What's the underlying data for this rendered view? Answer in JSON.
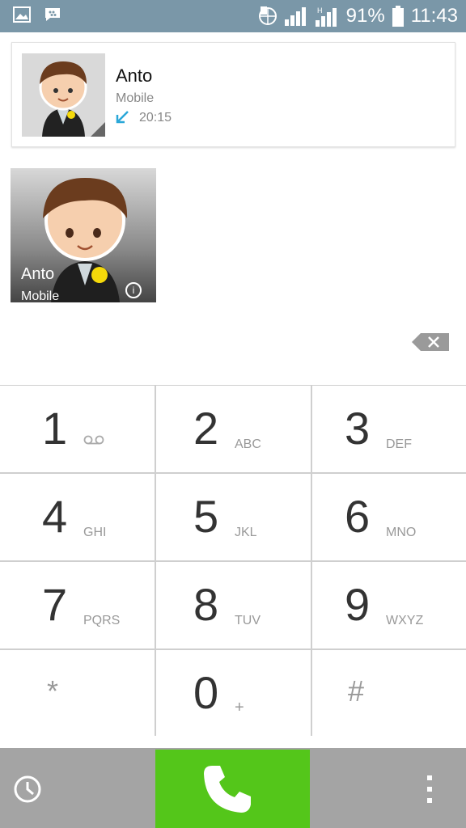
{
  "status_bar": {
    "battery_percent": "91%",
    "time": "11:43",
    "icons": [
      "gallery-icon",
      "bbm-icon",
      "data-sync-icon",
      "signal-icon",
      "hspa-signal-icon",
      "battery-icon"
    ]
  },
  "recent_call": {
    "name": "Anto",
    "type": "Mobile",
    "time": "20:15",
    "direction": "incoming"
  },
  "contact_tile": {
    "name": "Anto",
    "type": "Mobile",
    "info_glyph": "i"
  },
  "dialpad": {
    "keys": [
      {
        "digit": "1",
        "letters": ""
      },
      {
        "digit": "2",
        "letters": "ABC"
      },
      {
        "digit": "3",
        "letters": "DEF"
      },
      {
        "digit": "4",
        "letters": "GHI"
      },
      {
        "digit": "5",
        "letters": "JKL"
      },
      {
        "digit": "6",
        "letters": "MNO"
      },
      {
        "digit": "7",
        "letters": "PQRS"
      },
      {
        "digit": "8",
        "letters": "TUV"
      },
      {
        "digit": "9",
        "letters": "WXYZ"
      },
      {
        "digit": "*",
        "letters": ""
      },
      {
        "digit": "0",
        "letters": "+"
      },
      {
        "digit": "#",
        "letters": ""
      }
    ]
  },
  "colors": {
    "status_bar": "#7a97a8",
    "call_button": "#54c61a",
    "bottom_bar": "#a4a4a4",
    "incoming_arrow": "#2aa7d8"
  }
}
